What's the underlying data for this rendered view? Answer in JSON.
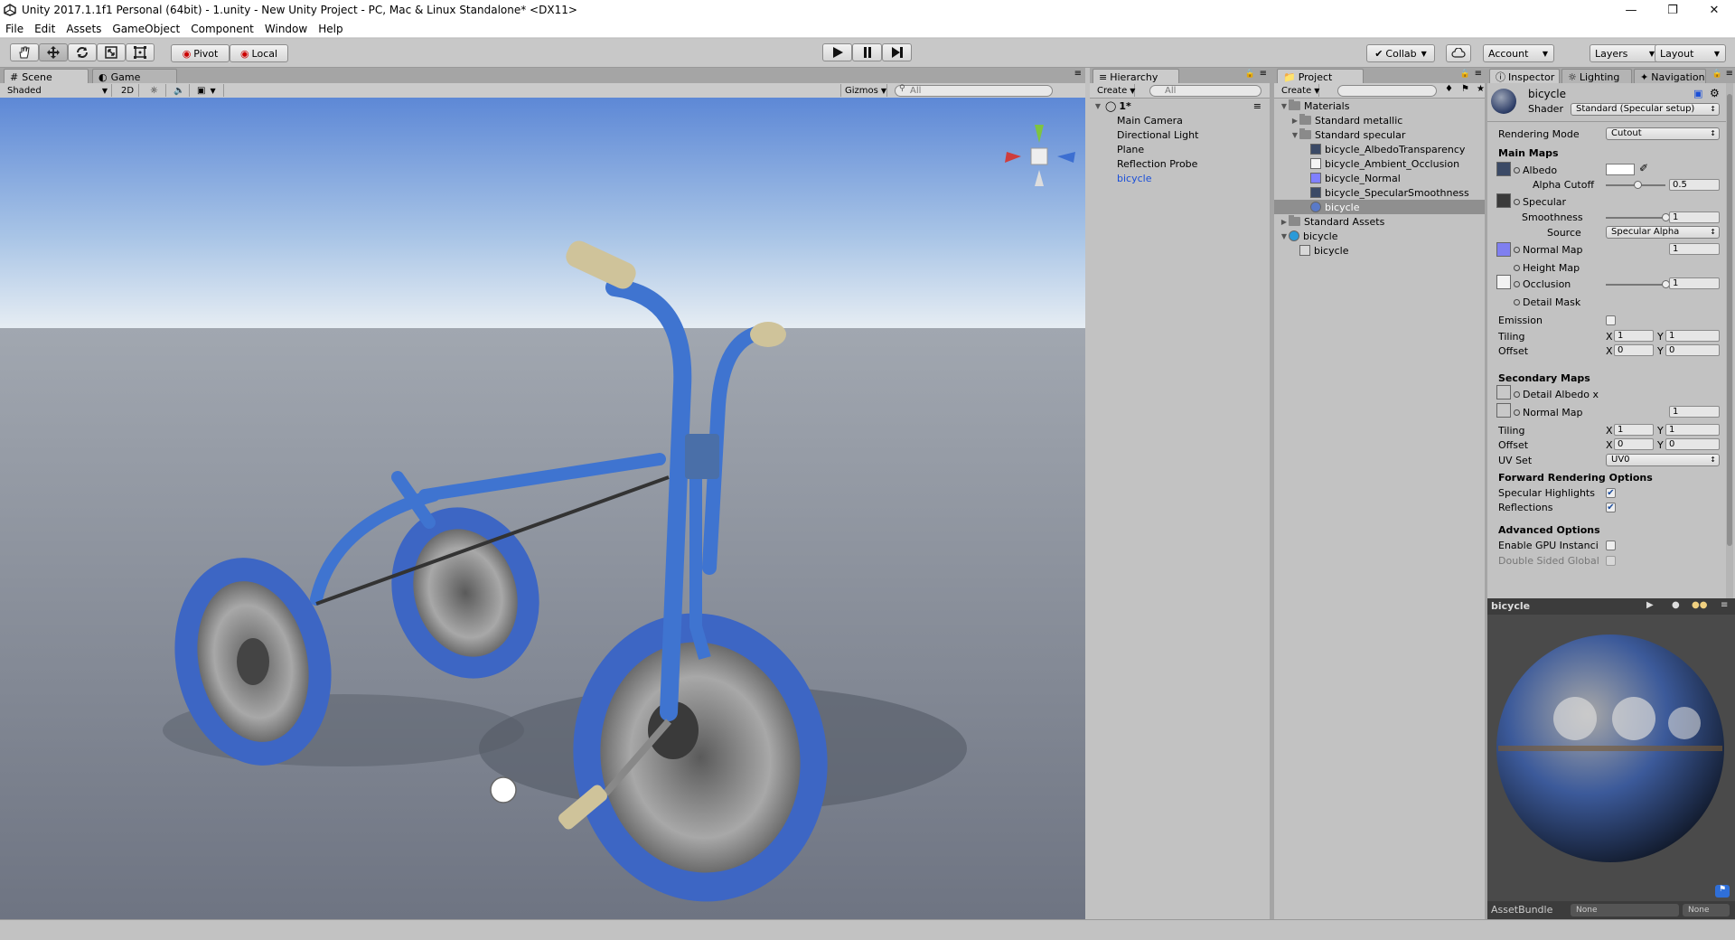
{
  "window": {
    "title": "Unity 2017.1.1f1 Personal (64bit) - 1.unity - New Unity Project - PC, Mac & Linux Standalone* <DX11>",
    "min": "—",
    "max": "❐",
    "close": "✕"
  },
  "menu": [
    "File",
    "Edit",
    "Assets",
    "GameObject",
    "Component",
    "Window",
    "Help"
  ],
  "toolbar": {
    "pivot": "Pivot",
    "local": "Local",
    "collab": "Collab",
    "account": "Account",
    "layers": "Layers",
    "layout": "Layout"
  },
  "scene": {
    "tab_scene": "Scene",
    "tab_game": "Game",
    "shading": "Shaded",
    "mode2d": "2D",
    "gizmos": "Gizmos",
    "search": "All"
  },
  "hierarchy": {
    "tab": "Hierarchy",
    "create": "Create",
    "search": "All",
    "scene_name": "1*",
    "items": [
      "Main Camera",
      "Directional Light",
      "Plane",
      "Reflection Probe",
      "bicycle"
    ],
    "selected_color": "#1a4fd8"
  },
  "project": {
    "tab": "Project",
    "create": "Create",
    "items": [
      {
        "label": "Materials",
        "level": 0,
        "icon": "folder",
        "tri": "▼"
      },
      {
        "label": "Standard metallic",
        "level": 1,
        "icon": "folder",
        "tri": "▶"
      },
      {
        "label": "Standard specular",
        "level": 1,
        "icon": "folder",
        "tri": "▼"
      },
      {
        "label": "bicycle_AlbedoTransparency",
        "level": 2,
        "icon": "tex-dark",
        "tri": ""
      },
      {
        "label": "bicycle_Ambient_Occlusion",
        "level": 2,
        "icon": "tex-light",
        "tri": ""
      },
      {
        "label": "bicycle_Normal",
        "level": 2,
        "icon": "tex-normal",
        "tri": ""
      },
      {
        "label": "bicycle_SpecularSmoothness",
        "level": 2,
        "icon": "tex-dark",
        "tri": ""
      },
      {
        "label": "bicycle",
        "level": 2,
        "icon": "material",
        "tri": "",
        "selected": true
      },
      {
        "label": "Standard Assets",
        "level": 0,
        "icon": "folder",
        "tri": "▶"
      },
      {
        "label": "bicycle",
        "level": 0,
        "icon": "prefab",
        "tri": "▼"
      },
      {
        "label": "bicycle",
        "level": 1,
        "icon": "mesh",
        "tri": ""
      }
    ]
  },
  "inspector": {
    "tab_inspector": "Inspector",
    "tab_lighting": "Lighting",
    "tab_navigation": "Navigation",
    "material_name": "bicycle",
    "shader_label": "Shader",
    "shader_value": "Standard (Specular setup)",
    "rendering_mode_label": "Rendering Mode",
    "rendering_mode_value": "Cutout",
    "main_maps": "Main Maps",
    "albedo": "Albedo",
    "alpha_cutoff": "Alpha Cutoff",
    "alpha_cutoff_value": "0.5",
    "specular": "Specular",
    "smoothness": "Smoothness",
    "smoothness_value": "1",
    "source": "Source",
    "source_value": "Specular Alpha",
    "normal_map": "Normal Map",
    "normal_value": "1",
    "height_map": "Height Map",
    "occlusion": "Occlusion",
    "occlusion_value": "1",
    "detail_mask": "Detail Mask",
    "emission": "Emission",
    "tiling": "Tiling",
    "offset": "Offset",
    "x": "X",
    "y": "Y",
    "one": "1",
    "zero": "0",
    "secondary_maps": "Secondary Maps",
    "detail_albedo": "Detail Albedo x",
    "sec_normal_map": "Normal Map",
    "sec_normal_value": "1",
    "uv_set": "UV Set",
    "uv_value": "UV0",
    "forward": "Forward Rendering Options",
    "spec_highlights": "Specular Highlights",
    "reflections": "Reflections",
    "advanced": "Advanced Options",
    "gpu_instancing": "Enable GPU Instanci",
    "double_sided": "Double Sided Global",
    "preview_name": "bicycle",
    "asset_bundle": "AssetBundle",
    "ab_value": "None",
    "ab_variant": "None",
    "alpha_cutoff_fraction": 0.5,
    "smoothness_fraction": 1.0,
    "occlusion_fraction": 1.0
  }
}
